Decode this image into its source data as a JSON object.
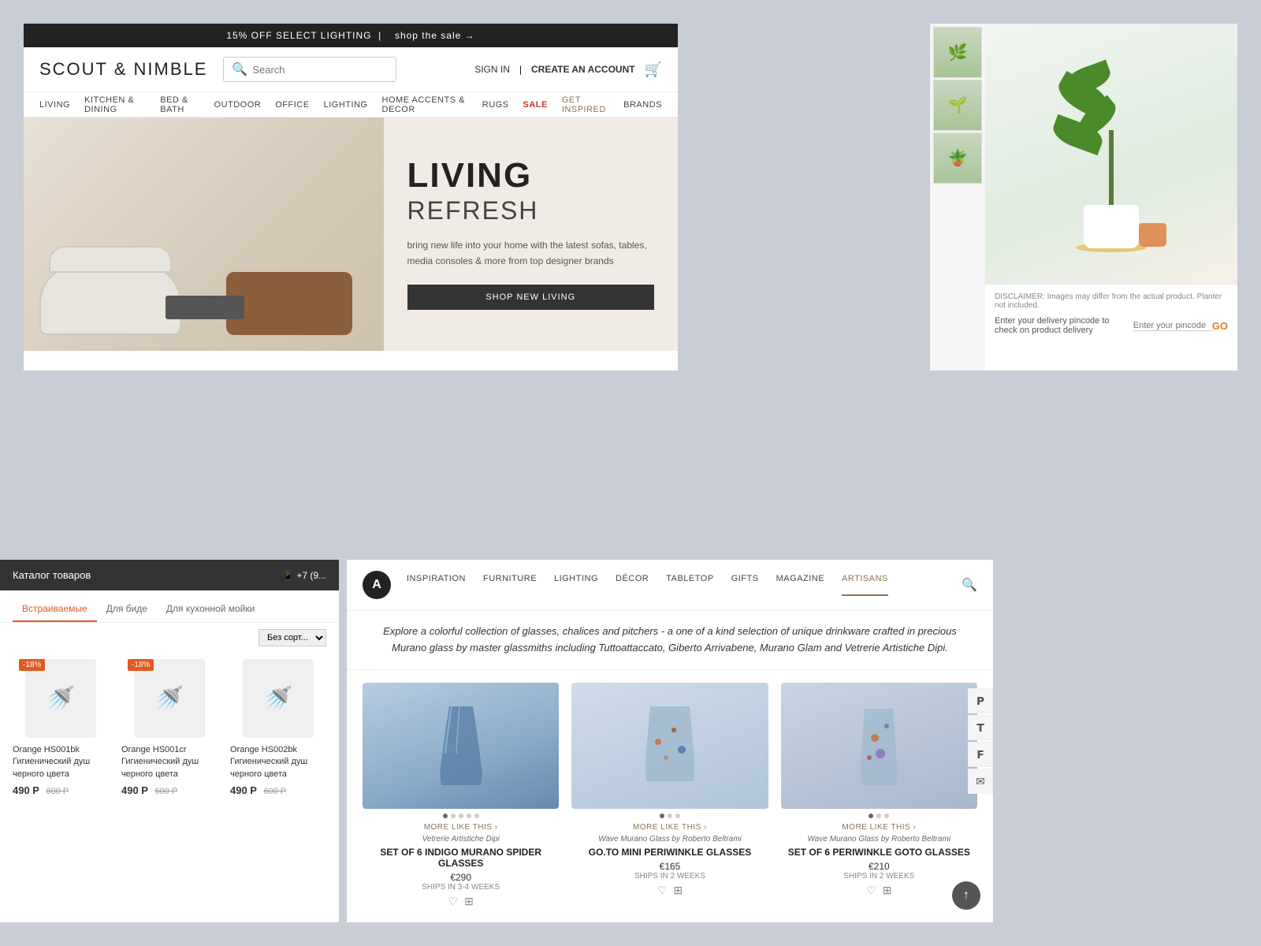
{
  "scout": {
    "promo_bar": "15% OFF SELECT LIGHTING",
    "promo_link": "shop the sale →",
    "logo": "SCOUT & NIMBLE",
    "search_placeholder": "Search",
    "sign_in": "SIGN IN",
    "create_account": "CREATE AN ACCOUNT",
    "nav": [
      "LIVING",
      "KITCHEN & DINING",
      "BED & BATH",
      "OUTDOOR",
      "OFFICE",
      "LIGHTING",
      "HOME ACCENTS & DECOR",
      "RUGS",
      "SALE",
      "GET INSPIRED",
      "BRANDS"
    ],
    "hero_title1": "LIVING",
    "hero_title2": "REFRESH",
    "hero_desc": "bring new life into your home with the latest sofas, tables, media consoles & more from top designer brands",
    "hero_cta": "SHOP NEW LIVING"
  },
  "product": {
    "disclaimer": "DISCLAIMER: Images may differ from the actual product. Planter not included.",
    "delivery_text": "Enter your delivery pincode to check on product delivery",
    "pincode_placeholder": "Enter your pincode",
    "go_label": "GO"
  },
  "russian": {
    "catalog": "Каталог товаров",
    "phone": "+7 (9...",
    "tabs": [
      "Встраиваемые",
      "Для биде",
      "Для кухонной мойки"
    ],
    "sort_label": "Без сорт...",
    "products": [
      {
        "badge": "-18%",
        "name": "Orange HS001bk Гигиенический душ черного цвета",
        "price_new": "490 Р",
        "price_old": "600 Р"
      },
      {
        "badge": "-18%",
        "name": "Orange HS001cr Гигиенический душ черного цвета",
        "price_new": "490 Р",
        "price_old": "600 Р"
      },
      {
        "badge": "",
        "name": "Orange HS002bk Гигиенический душ черного цвета",
        "price_new": "490 Р",
        "price_old": "600 Р"
      }
    ]
  },
  "artisans": {
    "logo_char": "A",
    "nav": [
      "INSPIRATION",
      "FURNITURE",
      "LIGHTING",
      "DÉCOR",
      "TABLETOP",
      "GIFTS",
      "MAGAZINE",
      "ARTISANS"
    ],
    "active_nav": "ARTISANS",
    "tagline": "Explore a colorful collection of glasses, chalices and pitchers - a one of a kind selection of unique drinkware crafted in precious Murano glass by master glassmiths including Tuttoattaccato, Giberto Arrivabene, Murano Glam and Vetrerie Artistiche Dipi.",
    "products": [
      {
        "more_link": "MORE LIKE THIS ›",
        "brand": "Vetrerie Artistiche Dipi",
        "title": "SET OF 6 INDIGO MURANO SPIDER GLASSES",
        "price": "€290",
        "shipping": "SHIPS IN 3-4 WEEKS",
        "dots": [
          true,
          false,
          false,
          false,
          false
        ]
      },
      {
        "more_link": "MORE LIKE THIS ›",
        "brand": "Wave Murano Glass by Roberto Beltrami",
        "title": "GO.TO MINI PERIWINKLE GLASSES",
        "price": "€165",
        "shipping": "SHIPS IN 2 WEEKS",
        "dots": [
          true,
          false,
          false
        ]
      },
      {
        "more_link": "MORE LIKE THIS ›",
        "brand": "Wave Murano Glass by Roberto Beltrami",
        "title": "SET OF 6 PERIWINKLE GOTO GLASSES",
        "price": "€210",
        "shipping": "SHIPS IN 2 WEEKS",
        "dots": [
          true,
          false,
          false
        ]
      }
    ],
    "social": [
      "𝐏",
      "𝐓",
      "𝐟",
      "✉"
    ],
    "scroll_top": "↑"
  }
}
